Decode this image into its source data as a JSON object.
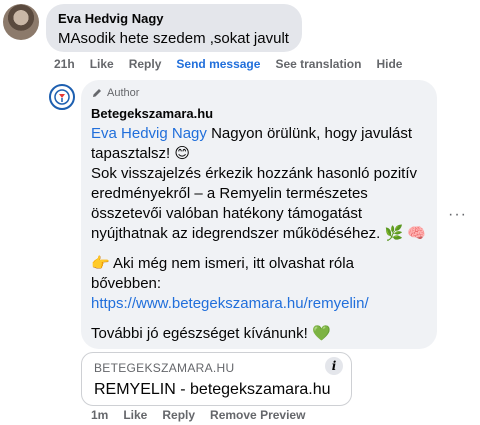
{
  "comment": {
    "author": "Eva Hedvig Nagy",
    "text": "MAsodik hete szedem ,sokat javult",
    "time": "21h",
    "like": "Like",
    "reply": "Reply",
    "send_message": "Send message",
    "see_translation": "See translation",
    "hide": "Hide"
  },
  "reply": {
    "badge": "Author",
    "page_name": "Betegekszamara.hu",
    "mention": "Eva Hedvig Nagy",
    "line1": "Nagyon örülünk, hogy javulást tapasztalsz! 😊",
    "para1": "Sok visszajelzés érkezik hozzánk hasonló pozitív eredményekről – a Remyelin természetes összetevői valóban hatékony támogatást nyújthatnak az idegrendszer működéséhez. 🌿 🧠",
    "para2": "👉 Aki még nem ismeri, itt olvashat róla bővebben:",
    "link": "https://www.betegekszamara.hu/remyelin/",
    "para3": "További jó egészséget kívánunk! 💚",
    "time": "1m",
    "like": "Like",
    "reply": "Reply",
    "remove_preview": "Remove Preview"
  },
  "link_preview": {
    "domain": "BETEGEKSZAMARA.HU",
    "title": "REMYELIN - betegekszamara.hu"
  },
  "more_options": "···",
  "info_glyph": "i"
}
